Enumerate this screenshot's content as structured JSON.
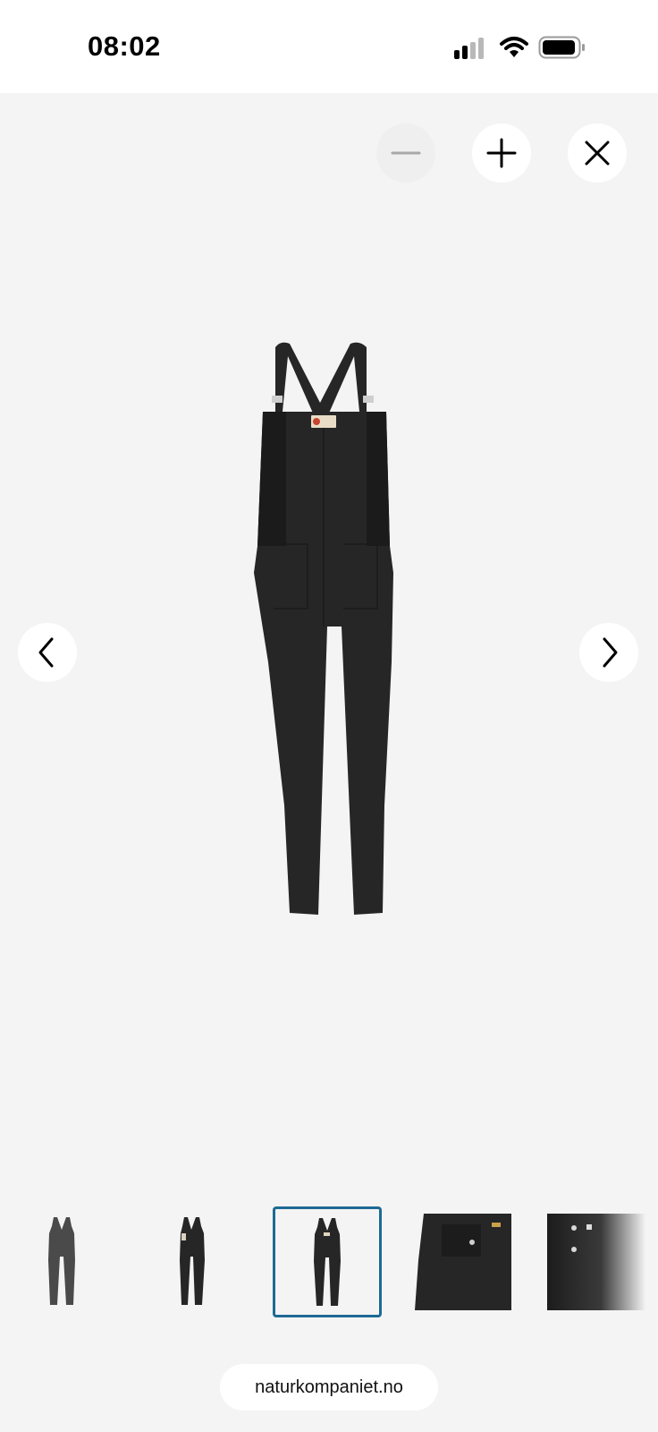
{
  "status_bar": {
    "time": "08:02",
    "icons": [
      "signal-icon",
      "wifi-icon",
      "battery-icon"
    ]
  },
  "viewer": {
    "controls": {
      "zoom_out": {
        "icon": "minus-icon",
        "enabled": false
      },
      "zoom_in": {
        "icon": "plus-icon",
        "enabled": true
      },
      "close": {
        "icon": "close-icon"
      },
      "previous": {
        "icon": "chevron-left-icon"
      },
      "next": {
        "icon": "chevron-right-icon"
      }
    },
    "thumbnails": [
      {
        "name": "grey-overalls-front"
      },
      {
        "name": "black-overalls-side"
      },
      {
        "name": "black-overalls-back",
        "selected": true
      },
      {
        "name": "pocket-closeup"
      },
      {
        "name": "button-closeup"
      }
    ]
  },
  "browser": {
    "url": "naturkompaniet.no"
  },
  "colors": {
    "background": "#f4f4f4",
    "selected_border": "#1e6a95",
    "garment": "#262626"
  }
}
